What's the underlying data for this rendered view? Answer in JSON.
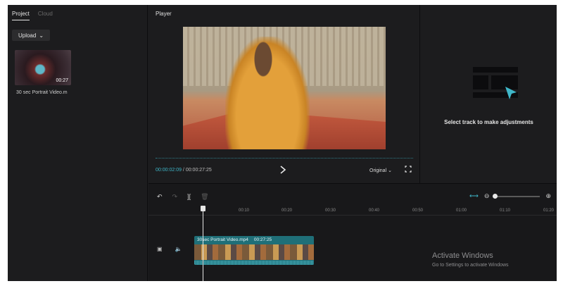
{
  "left_panel": {
    "tabs": [
      {
        "label": "Project"
      },
      {
        "label": "Cloud"
      }
    ],
    "upload_label": "Upload",
    "media": [
      {
        "name": "30 sec Portrait Video.m",
        "duration": "00:27"
      }
    ]
  },
  "player": {
    "title": "Player",
    "current_time": "00:00:02:09",
    "total_time": "00:00:27:25",
    "separator": " / ",
    "ratio_label": "Original"
  },
  "properties": {
    "message": "Select track to make adjustments"
  },
  "timeline": {
    "ruler": [
      "00:10",
      "00:20",
      "00:30",
      "00:40",
      "00:50",
      "01:00",
      "01:10",
      "01:20"
    ],
    "clip": {
      "name": "30sec Portrait Video.mp4",
      "duration": "00:27:25"
    }
  },
  "watermark": {
    "title": "Activate Windows",
    "subtitle": "Go to Settings to activate Windows"
  },
  "colors": {
    "accent": "#3fb7c9",
    "clip": "#1f6f78",
    "background": "#1c1c1e"
  },
  "icons": [
    "chevron-down-icon",
    "play-icon",
    "fullscreen-icon",
    "undo-icon",
    "redo-icon",
    "split-icon",
    "delete-icon",
    "link-icon",
    "zoom-out-icon",
    "zoom-in-icon",
    "cover-icon",
    "audio-icon"
  ]
}
